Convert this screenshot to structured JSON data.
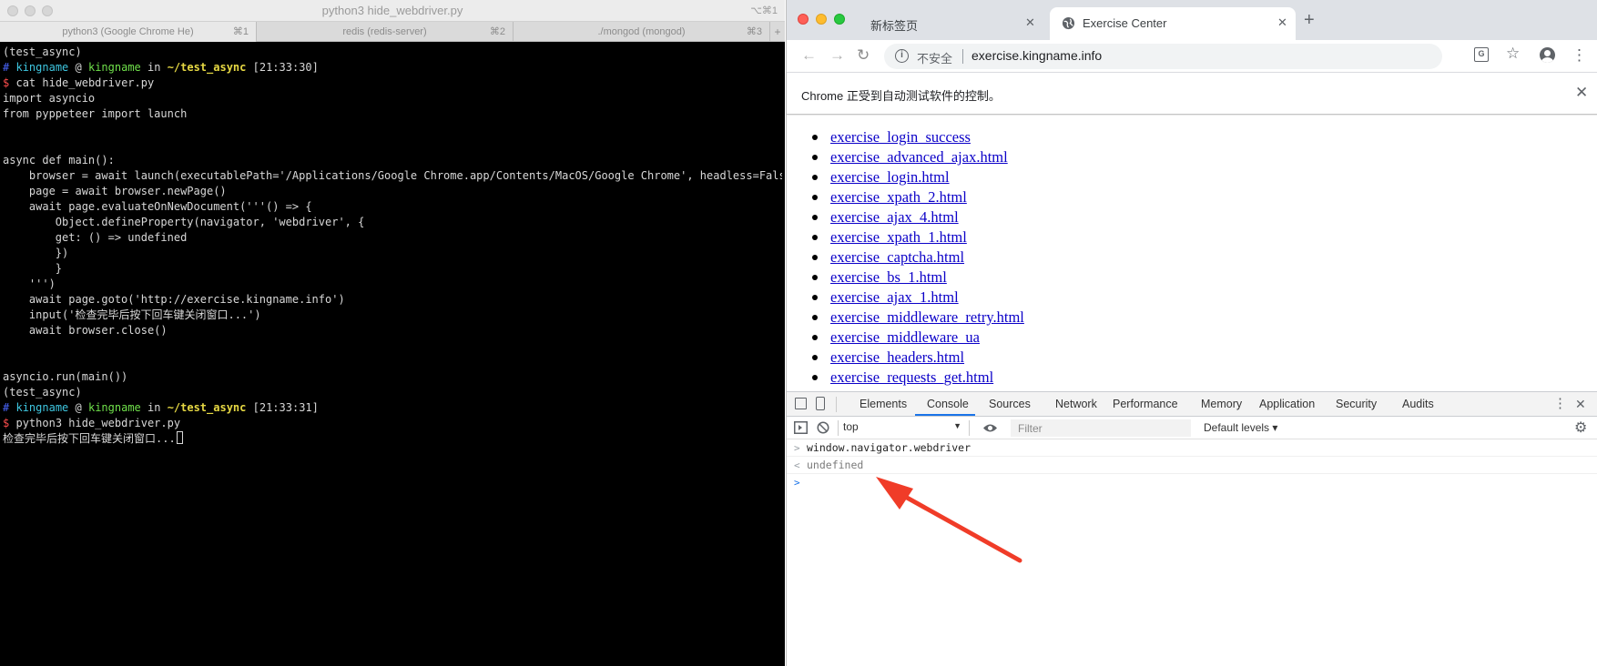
{
  "terminal": {
    "title": "python3 hide_webdriver.py",
    "shortcut": "⌥⌘1",
    "tabs": [
      {
        "label": "python3 (Google Chrome He)",
        "key": "⌘1"
      },
      {
        "label": "redis (redis-server)",
        "key": "⌘2"
      },
      {
        "label": "./mongod (mongod)",
        "key": "⌘3"
      }
    ],
    "add_tab": "+",
    "prompt1": {
      "env": "(test_async)",
      "hash": "#",
      "user": "kingname",
      "at": "@",
      "host": "kingname",
      "in": "in",
      "path": "~/test_async",
      "time": "[21:33:30]",
      "dollar": "$",
      "command": "cat hide_webdriver.py"
    },
    "code_lines": [
      "import asyncio",
      "from pyppeteer import launch",
      "",
      "",
      "async def main():",
      "    browser = await launch(executablePath='/Applications/Google Chrome.app/Contents/MacOS/Google Chrome', headless=False)",
      "    page = await browser.newPage()",
      "    await page.evaluateOnNewDocument('''() => {",
      "        Object.defineProperty(navigator, 'webdriver', {",
      "        get: () => undefined",
      "        })",
      "        }",
      "    ''')",
      "    await page.goto('http://exercise.kingname.info')",
      "    input('检查完毕后按下回车键关闭窗口...')",
      "    await browser.close()",
      "",
      "",
      "asyncio.run(main())"
    ],
    "prompt2": {
      "env": "(test_async)",
      "hash": "#",
      "user": "kingname",
      "at": "@",
      "host": "kingname",
      "in": "in",
      "path": "~/test_async",
      "time": "[21:33:31]",
      "dollar": "$",
      "command": "python3 hide_webdriver.py"
    },
    "output": "检查完毕后按下回车键关闭窗口..."
  },
  "chrome": {
    "tabs": [
      {
        "label": "新标签页",
        "close": "✕"
      },
      {
        "label": "Exercise Center",
        "close": "✕"
      }
    ],
    "new_tab": "+",
    "nav": {
      "back": "←",
      "forward": "→",
      "reload": "↻"
    },
    "omnibox": {
      "info": "i",
      "not_secure": "不安全",
      "url": "exercise.kingname.info"
    },
    "toolbar_icons": {
      "translate": "G",
      "bookmark": "☆",
      "menu": "⋮"
    },
    "infobar": {
      "text": "Chrome 正受到自动测试软件的控制。",
      "close": "✕"
    },
    "links": [
      "exercise_login_success",
      "exercise_advanced_ajax.html",
      "exercise_login.html",
      "exercise_xpath_2.html",
      "exercise_ajax_4.html",
      "exercise_xpath_1.html",
      "exercise_captcha.html",
      "exercise_bs_1.html",
      "exercise_ajax_1.html",
      "exercise_middleware_retry.html",
      "exercise_middleware_ua",
      "exercise_headers.html",
      "exercise_requests_get.html"
    ],
    "devtools": {
      "tabs": [
        "Elements",
        "Console",
        "Sources",
        "Network",
        "Performance",
        "Memory",
        "Application",
        "Security",
        "Audits"
      ],
      "active_tab": "Console",
      "more": "⋮",
      "close": "✕",
      "context": "top",
      "filter_placeholder": "Filter",
      "levels": "Default levels ▾",
      "console_lines": [
        {
          "glyph": ">",
          "text": "window.navigator.webdriver"
        },
        {
          "glyph": "<",
          "text": "undefined"
        },
        {
          "glyph": ">",
          "text": ""
        }
      ],
      "accent": "#1a73e8"
    }
  },
  "annotation": {
    "arrow_color": "#f03c28"
  }
}
